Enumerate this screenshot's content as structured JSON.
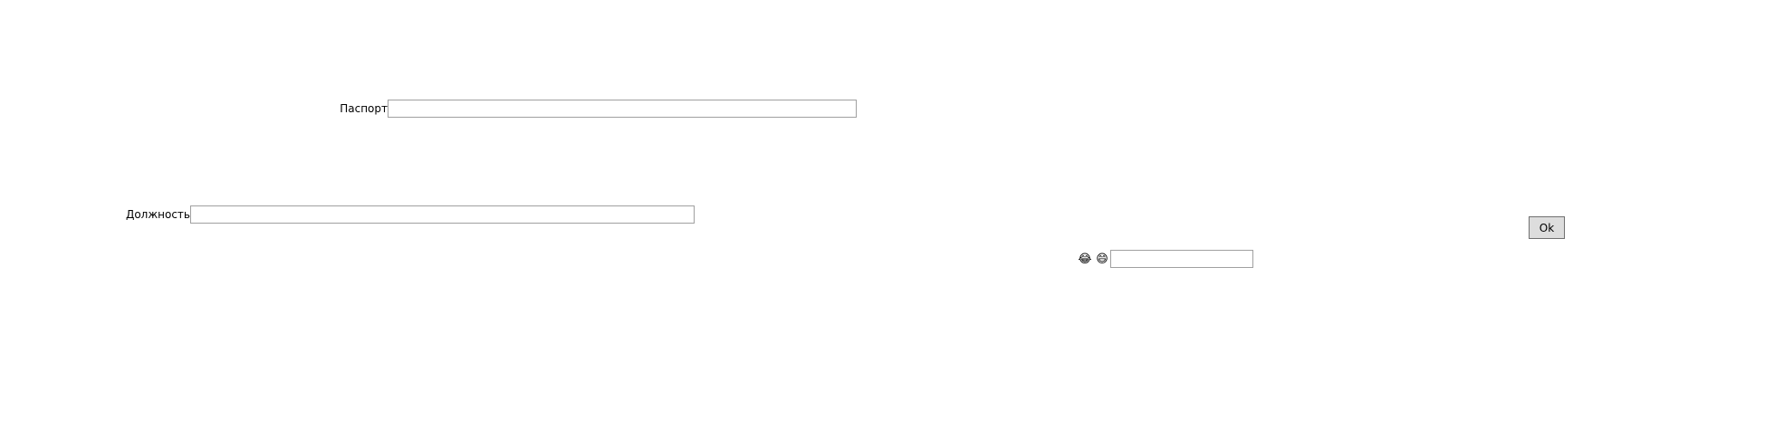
{
  "form": {
    "passport_label": "Паспорт",
    "passport_value": "",
    "position_label": "Должность",
    "position_value": "",
    "ok_label": "Ok",
    "emoji_1": "😂",
    "emoji_2": "😄",
    "small_field_value": ""
  }
}
